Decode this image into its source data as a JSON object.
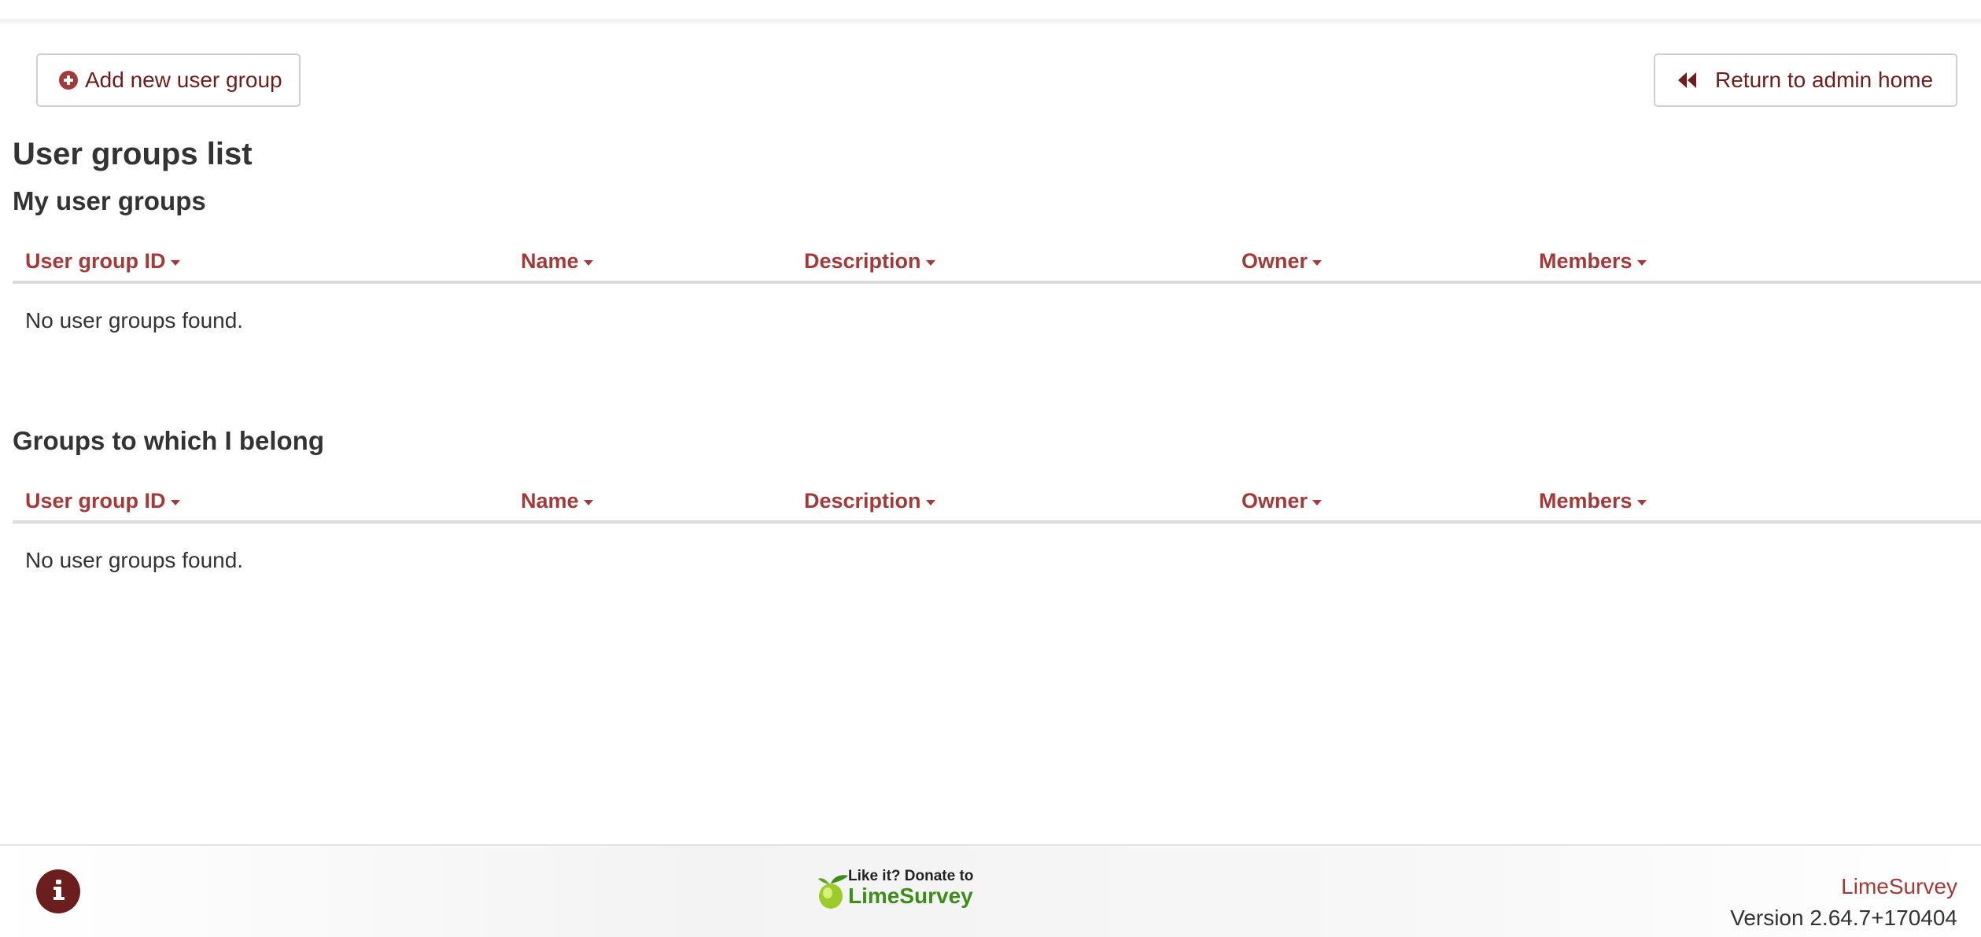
{
  "toolbar": {
    "add_group_label": "Add new user group",
    "return_label": "Return to admin home"
  },
  "page": {
    "title": "User groups list"
  },
  "my_groups": {
    "title": "My user groups",
    "columns": [
      "User group ID",
      "Name",
      "Description",
      "Owner",
      "Members"
    ],
    "empty_text": "No user groups found."
  },
  "member_groups": {
    "title": "Groups to which I belong",
    "columns": [
      "User group ID",
      "Name",
      "Description",
      "Owner",
      "Members"
    ],
    "empty_text": "No user groups found."
  },
  "footer": {
    "donate_line1": "Like it? Donate to",
    "donate_brand": "LimeSurvey",
    "brand_link": "LimeSurvey",
    "version": "Version 2.64.7+170404"
  },
  "colors": {
    "accent": "#a33a3a",
    "dark_accent": "#6c1d1d",
    "lime_green": "#3e8d1a"
  },
  "icons": {
    "add": "plus-circle-icon",
    "return": "fast-backward-icon",
    "info": "info-icon",
    "donate": "lime-fruit-icon",
    "sort": "caret-down-icon"
  }
}
